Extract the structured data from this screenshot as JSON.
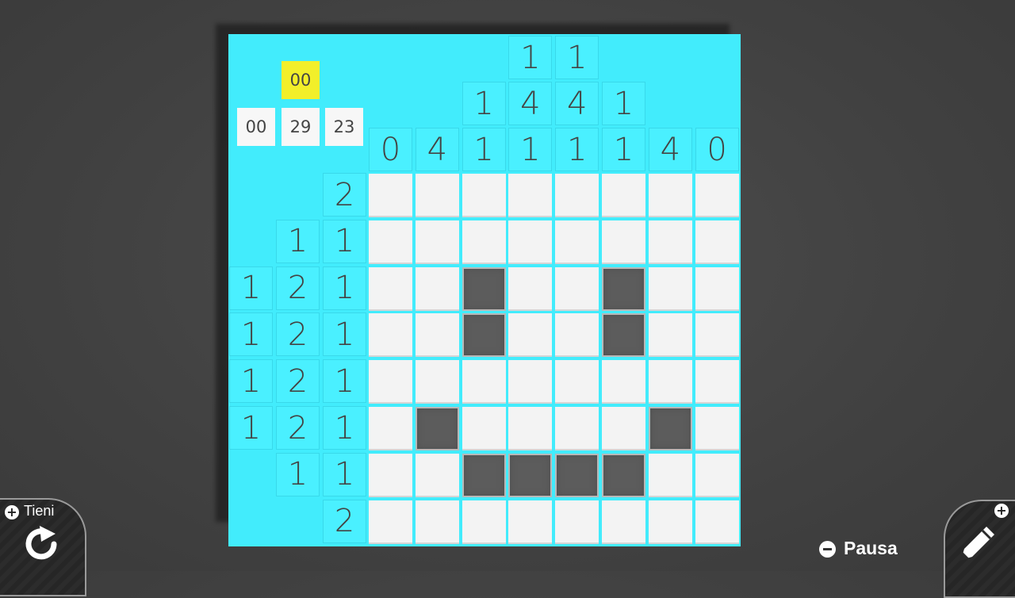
{
  "timer": {
    "hours": "00",
    "parts": [
      "00",
      "29",
      "23"
    ]
  },
  "column_clues": [
    [
      "0"
    ],
    [
      "4"
    ],
    [
      "1",
      "1"
    ],
    [
      "1",
      "4",
      "1"
    ],
    [
      "1",
      "4",
      "1"
    ],
    [
      "1",
      "1"
    ],
    [
      "4"
    ],
    [
      "0"
    ]
  ],
  "row_clues": [
    [
      "2"
    ],
    [
      "1",
      "1"
    ],
    [
      "1",
      "2",
      "1"
    ],
    [
      "1",
      "2",
      "1"
    ],
    [
      "1",
      "2",
      "1"
    ],
    [
      "1",
      "2",
      "1"
    ],
    [
      "1",
      "1"
    ],
    [
      "2"
    ]
  ],
  "grid": [
    [
      0,
      0,
      0,
      0,
      0,
      0,
      0,
      0
    ],
    [
      0,
      0,
      0,
      0,
      0,
      0,
      0,
      0
    ],
    [
      0,
      0,
      1,
      0,
      0,
      1,
      0,
      0
    ],
    [
      0,
      0,
      1,
      0,
      0,
      1,
      0,
      0
    ],
    [
      0,
      0,
      0,
      0,
      0,
      0,
      0,
      0
    ],
    [
      0,
      1,
      0,
      0,
      0,
      0,
      1,
      0
    ],
    [
      0,
      0,
      1,
      1,
      1,
      1,
      0,
      0
    ],
    [
      0,
      0,
      0,
      0,
      0,
      0,
      0,
      0
    ]
  ],
  "controls": {
    "hold_label": "Tieni",
    "pause_label": "Pausa",
    "hold_icon": "rotate-icon",
    "pencil_icon": "pencil-icon"
  },
  "colors": {
    "clue_panel": "#42ecfc",
    "timer_highlight": "#f2ef2a",
    "filled_cell": "#5c5c5c",
    "empty_cell": "#f3f3f3"
  }
}
